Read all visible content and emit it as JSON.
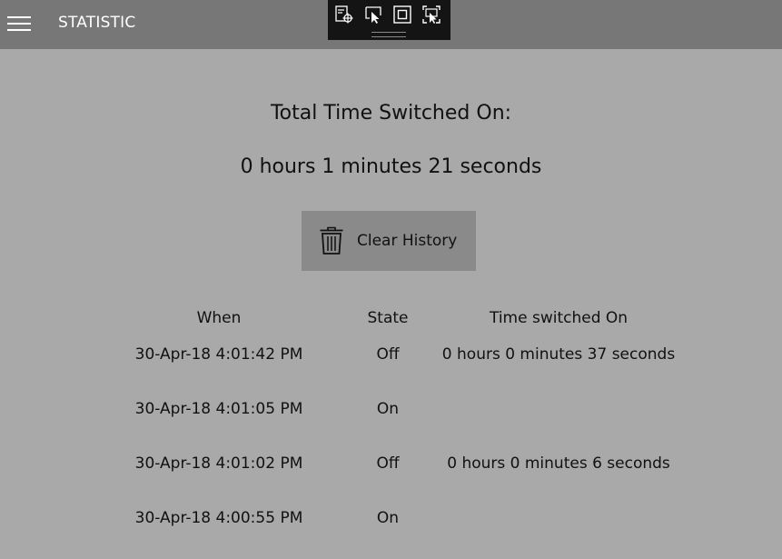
{
  "header": {
    "title": "STATISTIC"
  },
  "summary": {
    "label": "Total Time Switched On:",
    "value": "0 hours 1 minutes 21 seconds"
  },
  "actions": {
    "clear_history": "Clear History"
  },
  "history": {
    "columns": [
      "When",
      "State",
      "Time switched On"
    ],
    "rows": [
      {
        "when": "30-Apr-18 4:01:42 PM",
        "state": "Off",
        "duration": "0 hours 0 minutes 37 seconds"
      },
      {
        "when": "30-Apr-18 4:01:05 PM",
        "state": "On",
        "duration": ""
      },
      {
        "when": "30-Apr-18 4:01:02 PM",
        "state": "Off",
        "duration": "0 hours 0 minutes 6 seconds"
      },
      {
        "when": "30-Apr-18 4:00:55 PM",
        "state": "On",
        "duration": ""
      }
    ]
  },
  "colors": {
    "background": "#a9a9a9",
    "header_bar": "#777777",
    "button": "#8a8a8a",
    "debug_toolbar": "#141414"
  },
  "icons": {
    "menu": "hamburger-icon",
    "trash": "trash-icon",
    "debug_tools": [
      "select-element-icon",
      "live-visual-tree-icon",
      "layout-adorner-icon",
      "track-focus-icon"
    ]
  }
}
